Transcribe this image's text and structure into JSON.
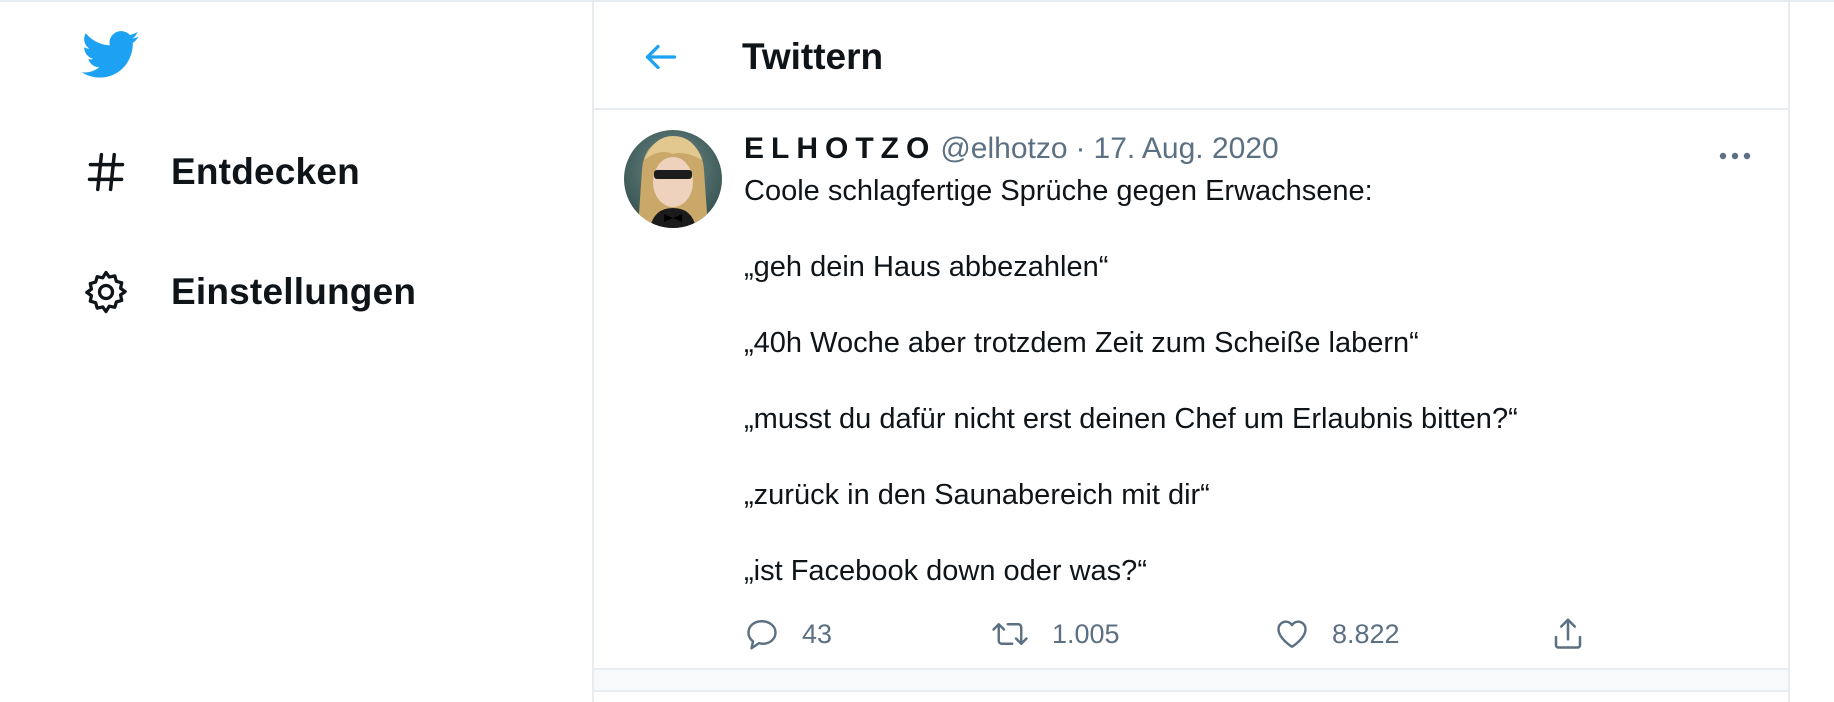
{
  "colors": {
    "accent": "#1da1f2",
    "text": "#0f1419",
    "secondary": "#5b7083",
    "border": "#e6ecf0"
  },
  "sidebar": {
    "logo": "twitter-bird-icon",
    "items": [
      {
        "label": "Entdecken",
        "icon": "hashtag-icon"
      },
      {
        "label": "Einstellungen",
        "icon": "gear-icon"
      }
    ]
  },
  "header": {
    "title": "Twittern",
    "back_icon": "arrow-left-icon"
  },
  "tweet": {
    "display_name": "ELHOTZO",
    "handle": "@elhotzo",
    "separator": "·",
    "date": "17. Aug. 2020",
    "lines": [
      "Coole schlagfertige Sprüche gegen Erwachsene:",
      "„geh dein Haus abbezahlen“",
      "„40h Woche aber trotzdem Zeit zum Scheiße labern“",
      "„musst du dafür nicht erst deinen Chef um Erlaubnis bitten?“",
      "„zurück in den Saunabereich mit dir“",
      "„ist Facebook down oder was?“"
    ],
    "actions": {
      "reply_count": "43",
      "retweet_count": "1.005",
      "like_count": "8.822"
    }
  }
}
